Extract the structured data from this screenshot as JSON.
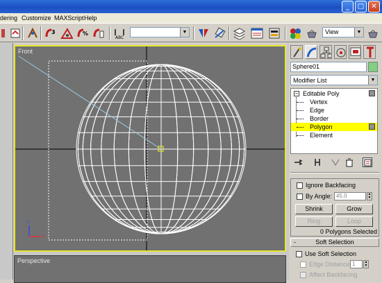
{
  "menubar": {
    "items": [
      "dering",
      "Customize",
      "MAXScript",
      "Help"
    ]
  },
  "window_buttons": {
    "minimize": "_",
    "maximize": "□",
    "close": "✕"
  },
  "toolbar": {
    "selection_set_value": "",
    "viewport_dropdown_value": "View",
    "icons": [
      "link-icon",
      "snap-3-icon",
      "angle-snap-icon",
      "percent-snap-icon",
      "spinner-snap-icon",
      "abc-icon",
      "mirror-icon",
      "align-icon",
      "layers-icon",
      "curve-editor-icon",
      "schematic-icon",
      "material-editor-icon",
      "render-scene-icon",
      "quick-render-icon"
    ]
  },
  "viewports": {
    "front": {
      "label": "Front",
      "axis_z": "z",
      "axis_x": "x"
    },
    "perspective": {
      "label": "Perspective"
    }
  },
  "command_panel": {
    "tabs": [
      "create",
      "modify",
      "hierarchy",
      "motion",
      "display",
      "utilities"
    ],
    "object_name": "Sphere01",
    "object_color": "#80d080",
    "modifier_list": "Modifier List",
    "stack": [
      {
        "label": "Editable Poly",
        "selected": false
      },
      {
        "label": "Vertex",
        "selected": false
      },
      {
        "label": "Edge",
        "selected": false
      },
      {
        "label": "Border",
        "selected": false
      },
      {
        "label": "Polygon",
        "selected": true
      },
      {
        "label": "Element",
        "selected": false
      }
    ],
    "stack_highlight_color": "#ffff00",
    "selection": {
      "ignore_backfacing": "Ignore Backfacing",
      "by_angle": "By Angle:",
      "by_angle_value": "45.0",
      "shrink": "Shrink",
      "grow": "Grow",
      "ring": "Ring",
      "loop": "Loop",
      "status": "0 Polygons Selected"
    },
    "soft_selection": {
      "header": "Soft Selection",
      "collapse_symbol": "-",
      "use_soft_selection": "Use Soft Selection",
      "edge_distance": "Edge Distance:",
      "edge_distance_value": "1",
      "affect_backfacing": "Affect Backfacing"
    }
  },
  "colors": {
    "viewport_bg": "#717171",
    "active_viewport_border": "#e6e62a",
    "titlebar": "#1f55c8"
  }
}
